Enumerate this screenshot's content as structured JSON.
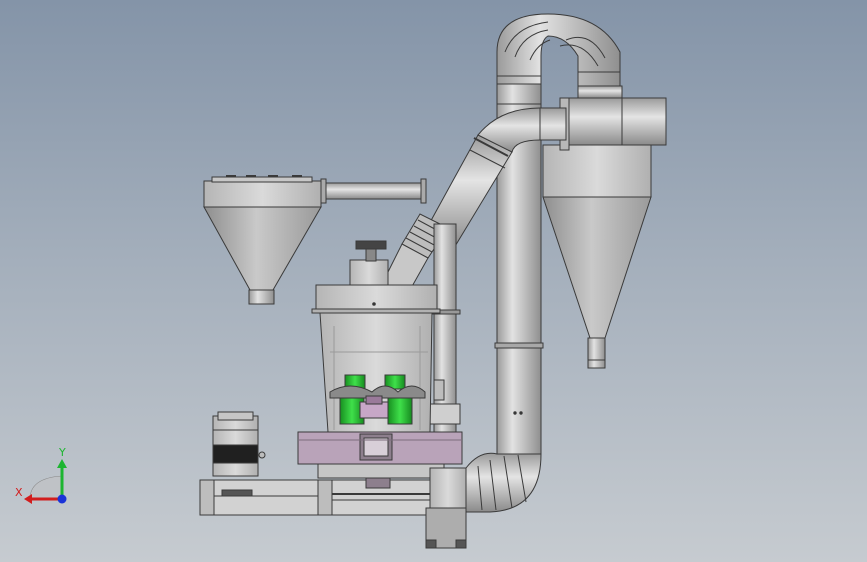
{
  "view": {
    "background_top": "#8494a8",
    "background_bottom": "#c6cbd0",
    "body_color": "#c5c5c5",
    "edge_color": "#3a3a3a",
    "roller_color": "#22c42e",
    "base_color": "#b9a3b9"
  },
  "triad": {
    "x_label": "X",
    "y_label": "Y",
    "x_color": "#d21d1d",
    "y_color": "#1db531",
    "z_color": "#1a33d8"
  }
}
